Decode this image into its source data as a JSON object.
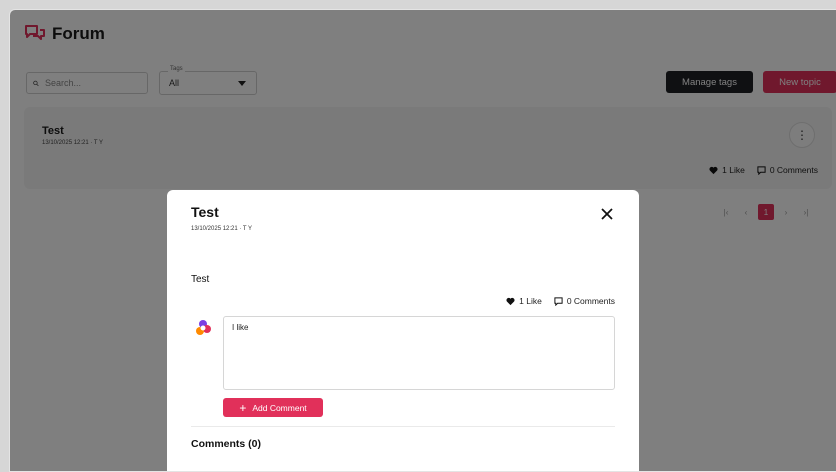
{
  "app": {
    "title": "Forum",
    "accent": "#e1305a"
  },
  "toolbar": {
    "search_placeholder": "Search...",
    "tags_label": "Tags",
    "tags_value": "All",
    "manage_tags_label": "Manage tags",
    "new_topic_label": "New topic"
  },
  "topic": {
    "title": "Test",
    "meta": "13/10/2025 12:21 · T Y",
    "likes": "1 Like",
    "comments": "0 Comments"
  },
  "pagination": {
    "first": "|‹",
    "prev": "‹",
    "current": "1",
    "next": "›",
    "last": "›|"
  },
  "modal": {
    "title": "Test",
    "meta": "13/10/2025 12:21 · T Y",
    "body": "Test",
    "likes": "1 Like",
    "comments": "0 Comments",
    "comment_value": "I like",
    "add_comment_label": "Add Comment",
    "comments_heading": "Comments (0)"
  }
}
